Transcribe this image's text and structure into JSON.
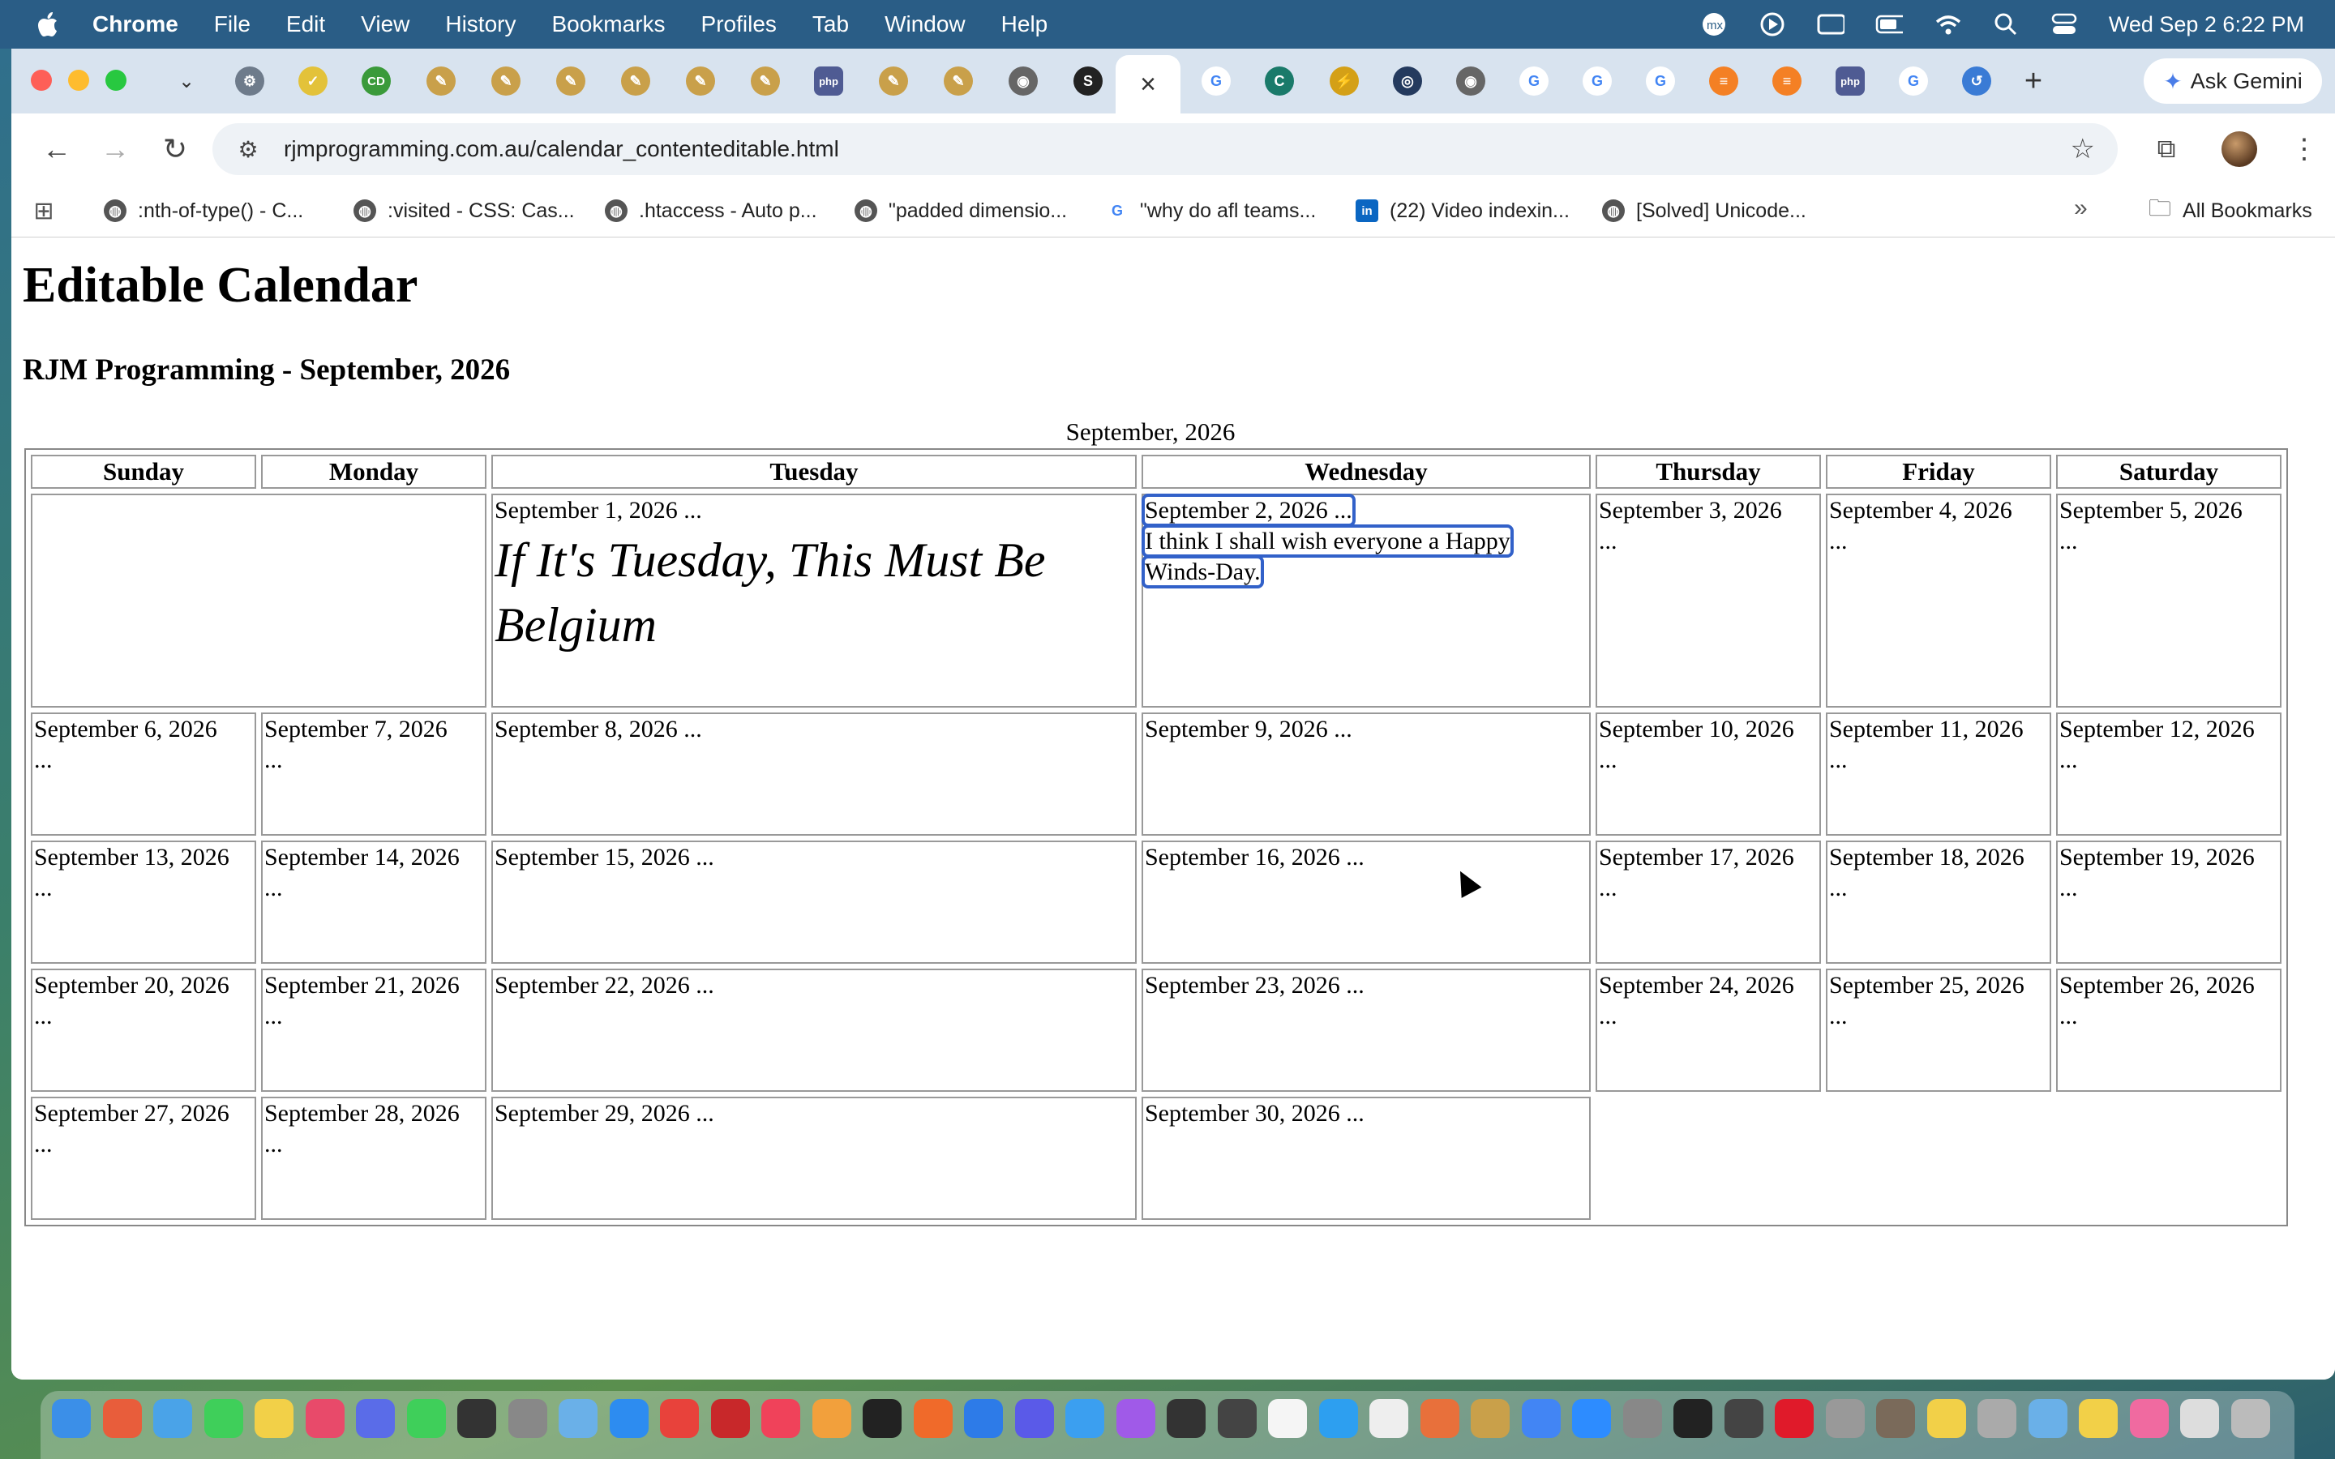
{
  "menubar": {
    "app_name": "Chrome",
    "items": [
      "File",
      "Edit",
      "View",
      "History",
      "Bookmarks",
      "Profiles",
      "Tab",
      "Window",
      "Help"
    ],
    "clock": "Wed Sep 2  6:22 PM",
    "status_icons": [
      "mx-icon",
      "play-icon",
      "caption-icon",
      "battery-icon",
      "wifi-icon",
      "search-icon",
      "control-center-icon"
    ]
  },
  "browser": {
    "active_tab_close": "×",
    "new_tab": "+",
    "gemini_label": "Ask Gemini",
    "url": "rjmprogramming.com.au/calendar_contenteditable.html",
    "bookmarks": [
      {
        "label": ":nth-of-type() - C...",
        "icon": "globe-icon"
      },
      {
        "label": ":visited - CSS: Cas...",
        "icon": "globe-icon"
      },
      {
        "label": ".htaccess - Auto p...",
        "icon": "globe-icon"
      },
      {
        "label": "\"padded dimensio...",
        "icon": "globe-icon"
      },
      {
        "label": "\"why do afl teams...",
        "icon": "google-icon"
      },
      {
        "label": "(22) Video indexin...",
        "icon": "linkedin-icon"
      },
      {
        "label": "[Solved] Unicode...",
        "icon": "globe-icon"
      }
    ],
    "bookmarks_more": "»",
    "all_bookmarks": "All Bookmarks"
  },
  "page": {
    "title": "Editable Calendar",
    "subtitle": "RJM Programming - September, 2026",
    "caption": "September, 2026",
    "weekdays": [
      "Sunday",
      "Monday",
      "Tuesday",
      "Wednesday",
      "Thursday",
      "Friday",
      "Saturday"
    ],
    "tuesday_note": "If It's Tuesday, This Must Be Belgium",
    "wednesday_line1": "September 2, 2026 ...",
    "wednesday_line2": "I think I shall wish everyone a Happy",
    "wednesday_line3": "Winds-Day.",
    "days": {
      "d1": "September 1, 2026 ...",
      "d3": "September 3, 2026",
      "d4": "September 4, 2026",
      "d5": "September 5, 2026",
      "d6": "September 6, 2026",
      "d7": "September 7, 2026",
      "d8": "September 8, 2026 ...",
      "d9": "September 9, 2026 ...",
      "d10": "September 10, 2026",
      "d11": "September 11, 2026",
      "d12": "September 12, 2026",
      "d13": "September 13, 2026",
      "d14": "September 14, 2026",
      "d15": "September 15, 2026 ...",
      "d16": "September 16, 2026 ...",
      "d17": "September 17, 2026",
      "d18": "September 18, 2026",
      "d19": "September 19, 2026",
      "d20": "September 20, 2026",
      "d21": "September 21, 2026",
      "d22": "September 22, 2026 ...",
      "d23": "September 23, 2026 ...",
      "d24": "September 24, 2026",
      "d25": "September 25, 2026",
      "d26": "September 26, 2026",
      "d27": "September 27, 2026",
      "d28": "September 28, 2026",
      "d29": "September 29, 2026 ...",
      "d30": "September 30, 2026 ..."
    },
    "ellipsis": "..."
  },
  "dock": {
    "apps": [
      "finder",
      "launchpad",
      "mail",
      "messages",
      "notes",
      "calendar",
      "freeform",
      "facetime",
      "terminal",
      "calculator",
      "preview",
      "app-store",
      "news",
      "filezilla",
      "music",
      "photos",
      "tv",
      "firefox",
      "xcode",
      "bbedit",
      "safari",
      "podcasts",
      "terminal-alt",
      "console",
      "calendar-2",
      "quicktime",
      "textedit",
      "intellij",
      "skim",
      "chrome",
      "zoom",
      "system-settings",
      "inkscape",
      "obs",
      "opera",
      "contacts",
      "gimp",
      "notes-2",
      "trash-utility",
      "preview-2",
      "stickies",
      "photos-2",
      "files",
      "trash"
    ]
  }
}
